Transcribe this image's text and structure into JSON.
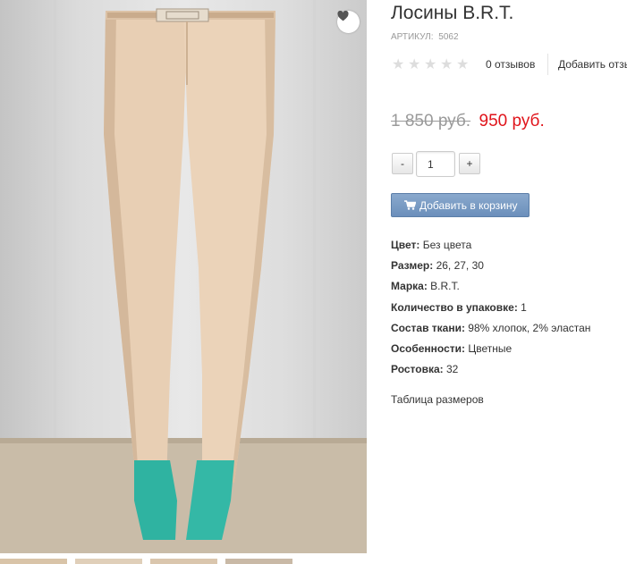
{
  "product": {
    "title": "Лосины B.R.T.",
    "sku_label": "АРТИКУЛ:",
    "sku_value": "5062"
  },
  "rating": {
    "value": 0,
    "max": 5,
    "reviews_count": "0 отзывов",
    "add_review": "Добавить отзыв"
  },
  "price": {
    "old": "1 850 руб.",
    "new": "950 руб."
  },
  "quantity": {
    "minus": "-",
    "value": "1",
    "plus": "+"
  },
  "cart": {
    "label": "Добавить в корзину",
    "icon": "cart-icon"
  },
  "attributes": [
    {
      "label": "Цвет:",
      "value": "Без цвета"
    },
    {
      "label": "Размер:",
      "value": "26, 27, 30"
    },
    {
      "label": "Марка:",
      "value": "B.R.T."
    },
    {
      "label": "Количество в упаковке:",
      "value": "1"
    },
    {
      "label": "Состав ткани:",
      "value": "98% хлопок, 2% эластан"
    },
    {
      "label": "Особенности:",
      "value": "Цветные"
    },
    {
      "label": "Ростовка:",
      "value": "32"
    }
  ],
  "size_table_link": "Таблица размеров",
  "icons": {
    "favorite": "heart-icon",
    "star": "star-icon"
  },
  "colors": {
    "old_price": "#9a9a9a",
    "new_price": "#e0141b",
    "cart_button": "#7496c2",
    "trousers": "#e8cfb4",
    "shoes": "#2fb3a1"
  }
}
